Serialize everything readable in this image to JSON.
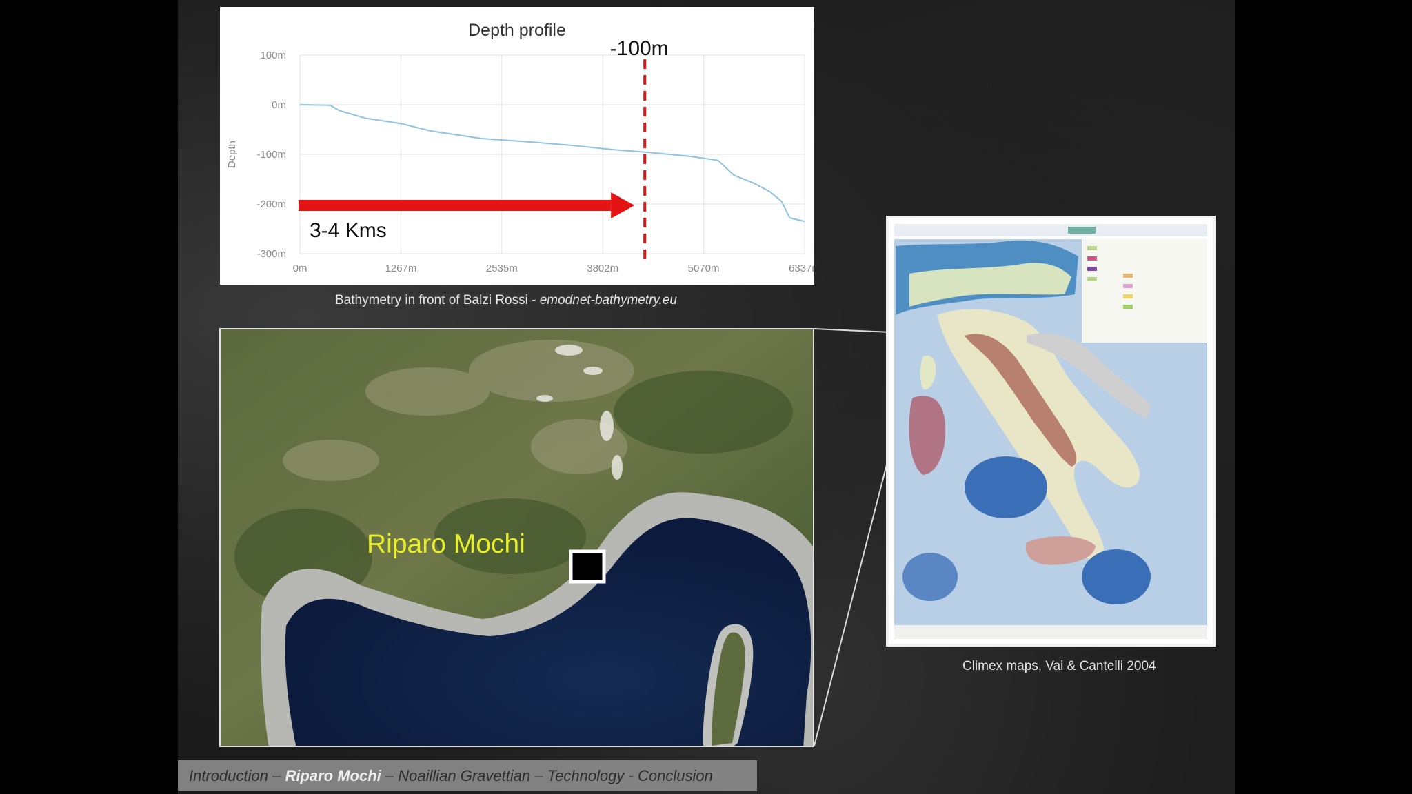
{
  "chart_data": {
    "type": "line",
    "title": "Depth profile",
    "ylabel": "Depth",
    "x_ticks": [
      "0m",
      "1267m",
      "2535m",
      "3802m",
      "5070m",
      "6337m"
    ],
    "y_ticks": [
      "100m",
      "0m",
      "-100m",
      "-200m",
      "-300m"
    ],
    "xlim": [
      0,
      6337
    ],
    "ylim": [
      -300,
      100
    ],
    "grid": true,
    "series": [
      {
        "color": "#8ec3e3",
        "x": [
          0,
          380,
          500,
          820,
          1270,
          1650,
          2280,
          2900,
          3420,
          3900,
          4380,
          4900,
          5250,
          5450,
          5700,
          5900,
          6050,
          6150,
          6337
        ],
        "y": [
          0,
          -1,
          -12,
          -27,
          -38,
          -53,
          -68,
          -75,
          -82,
          -90,
          -96,
          -104,
          -112,
          -142,
          -158,
          -175,
          -195,
          -228,
          -235
        ]
      }
    ],
    "annotations": {
      "marker_label": "-100m",
      "marker_x": 4330,
      "arrow_label": "3-4 Kms",
      "arrow_y": -200,
      "arrow_x_start": 0,
      "arrow_x_end": 4200
    }
  },
  "captions": {
    "chart_prefix": "Bathymetry in front of Balzi Rossi - ",
    "chart_source": "emodnet-bathymetry.eu",
    "italy_map": "Climex maps, Vai & Cantelli 2004"
  },
  "sat_map": {
    "site_label": "Riparo Mochi"
  },
  "nav": {
    "items": [
      "Introduction",
      "Riparo Mochi",
      "Noaillian Gravettian",
      "Technology",
      "Conclusion"
    ],
    "separators": [
      " – ",
      " – ",
      " – ",
      " - "
    ],
    "active_index": 1
  },
  "colors": {
    "arrow": "#e41414",
    "marker": "#e41414",
    "site_label": "#e8ee2a"
  }
}
